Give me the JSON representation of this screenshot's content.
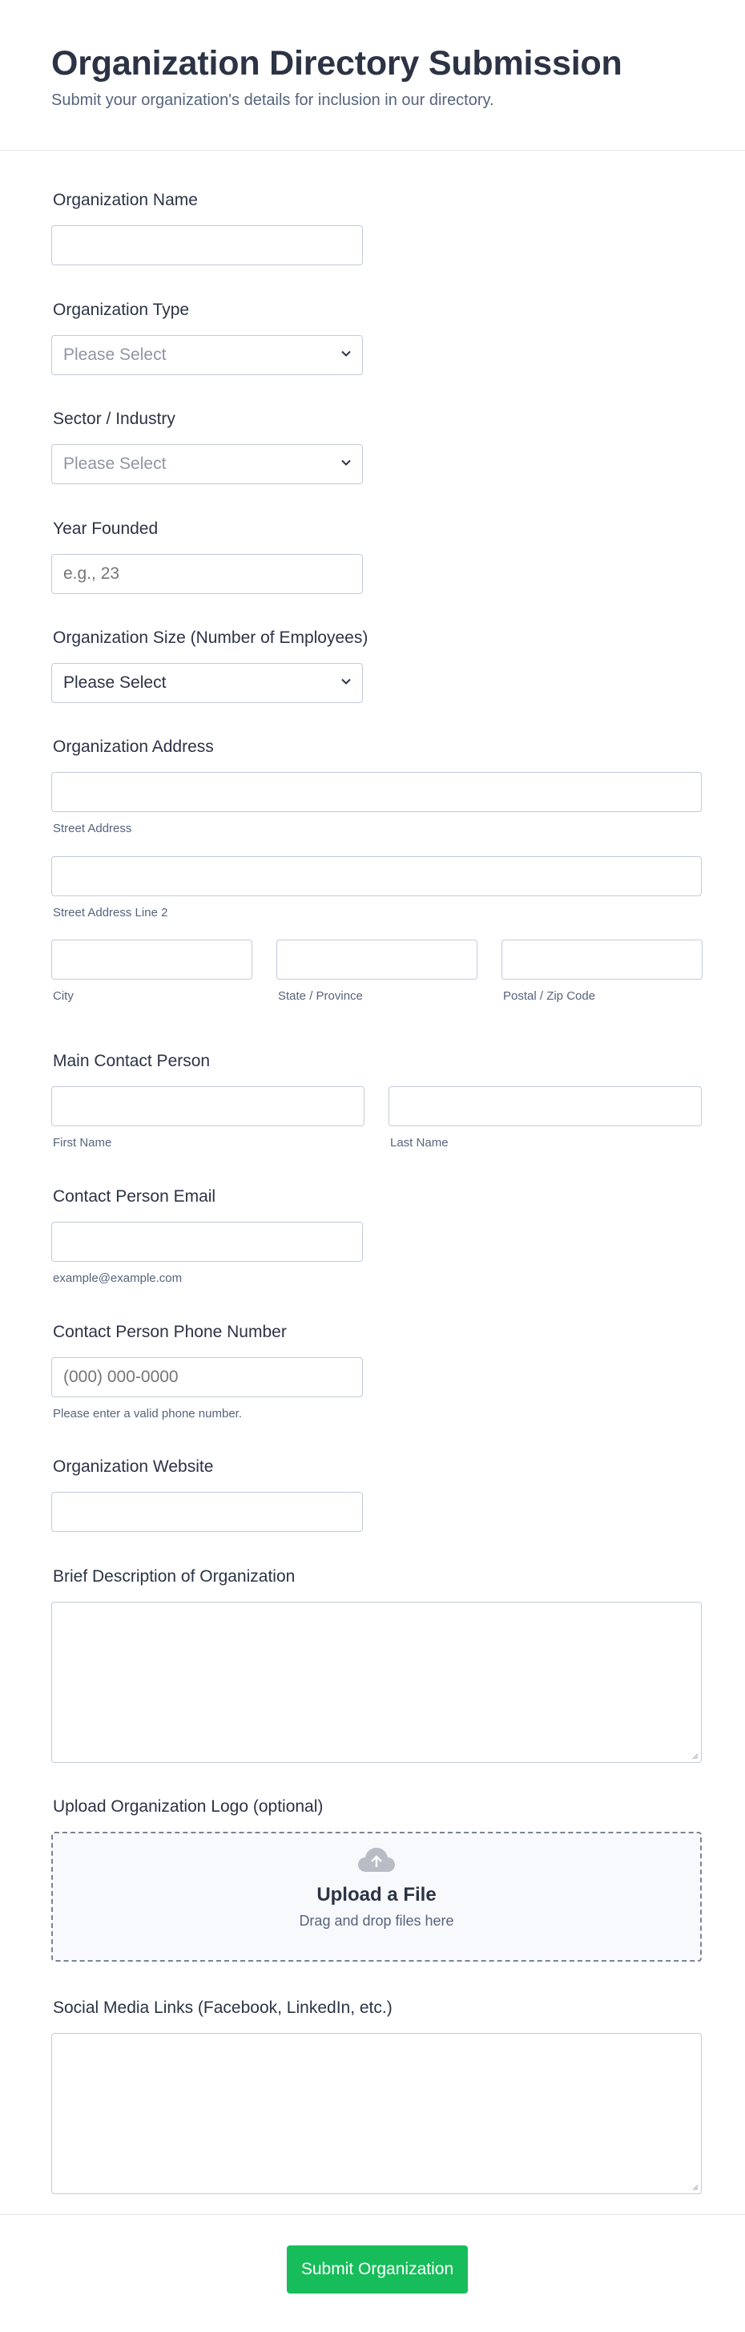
{
  "header": {
    "title": "Organization Directory Submission",
    "subtitle": "Submit your organization's details for inclusion in our directory."
  },
  "fields": {
    "org_name": {
      "label": "Organization Name",
      "value": ""
    },
    "org_type": {
      "label": "Organization Type",
      "selected": "Please Select"
    },
    "sector": {
      "label": "Sector / Industry",
      "selected": "Please Select"
    },
    "year_founded": {
      "label": "Year Founded",
      "placeholder": "e.g., 23"
    },
    "org_size": {
      "label": "Organization Size (Number of Employees)",
      "selected": "Please Select"
    },
    "address": {
      "label": "Organization Address",
      "street": "Street Address",
      "street2": "Street Address Line 2",
      "city": "City",
      "state": "State / Province",
      "zip": "Postal / Zip Code"
    },
    "contact": {
      "label": "Main Contact Person",
      "first": "First Name",
      "last": "Last Name"
    },
    "email": {
      "label": "Contact Person Email",
      "sublabel": "example@example.com"
    },
    "phone": {
      "label": "Contact Person Phone Number",
      "placeholder": "(000) 000-0000",
      "sublabel": "Please enter a valid phone number."
    },
    "website": {
      "label": "Organization Website"
    },
    "description": {
      "label": "Brief Description of Organization"
    },
    "logo": {
      "label": "Upload Organization Logo (optional)",
      "title": "Upload a File",
      "hint": "Drag and drop files here"
    },
    "social": {
      "label": "Social Media Links (Facebook, LinkedIn, etc.)"
    }
  },
  "submit": {
    "label": "Submit Organization",
    "color": "#18bd5b"
  },
  "icons": {
    "select_arrow": "chevron-down-icon",
    "upload": "cloud-upload-icon",
    "resize": "resize-grip-icon"
  }
}
